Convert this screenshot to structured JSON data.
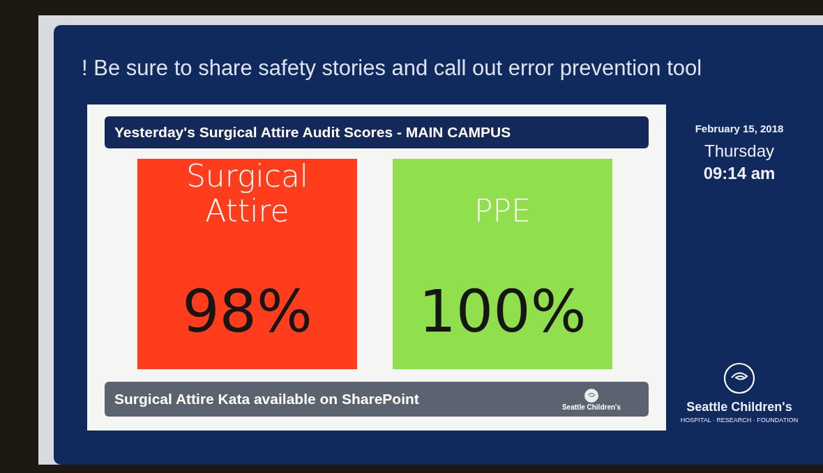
{
  "ticker": "! Be sure to share safety stories and call out error prevention tool",
  "panel": {
    "title": "Yesterday's Surgical Attire Audit Scores - MAIN CAMPUS",
    "tiles": [
      {
        "label_lines": [
          "Surgical",
          "Attire"
        ],
        "value": "98%",
        "color": "#ff3d1c"
      },
      {
        "label_lines": [
          "PPE"
        ],
        "value": "100%",
        "color": "#8fe04c"
      }
    ],
    "footer": "Surgical Attire Kata available on SharePoint",
    "footer_logo": "Seattle Children's"
  },
  "sidebar": {
    "date": "February 15, 2018",
    "weekday": "Thursday",
    "time": "09:14 am",
    "logo_name": "Seattle Children's",
    "logo_tagline": "HOSPITAL · RESEARCH · FOUNDATION"
  }
}
